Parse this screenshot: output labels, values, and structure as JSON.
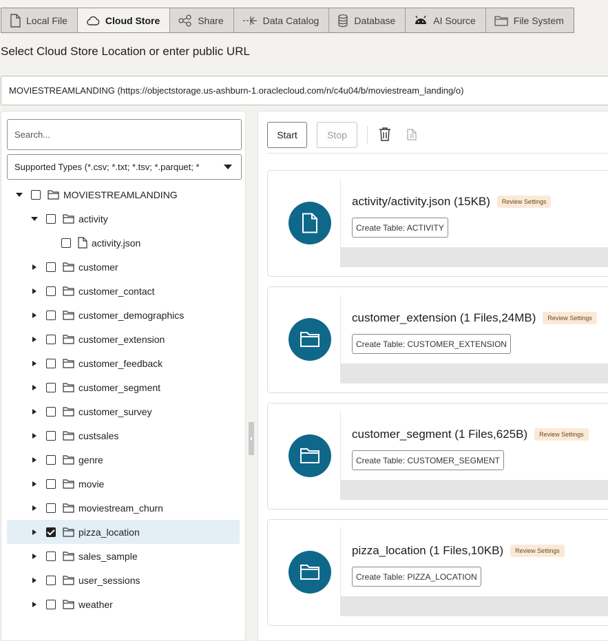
{
  "tabs": [
    {
      "label": "Local File",
      "icon": "file-icon",
      "active": false
    },
    {
      "label": "Cloud Store",
      "icon": "cloud-icon",
      "active": true
    },
    {
      "label": "Share",
      "icon": "share-icon",
      "active": false
    },
    {
      "label": "Data Catalog",
      "icon": "data-catalog-icon",
      "active": false
    },
    {
      "label": "Database",
      "icon": "database-icon",
      "active": false
    },
    {
      "label": "AI Source",
      "icon": "android-icon",
      "active": false
    },
    {
      "label": "File System",
      "icon": "folder-icon",
      "active": false
    }
  ],
  "page_title": "Select Cloud Store Location or enter public URL",
  "location": {
    "value": "MOVIESTREAMLANDING (https://objectstorage.us-ashburn-1.oraclecloud.com/n/c4u04/b/moviestream_landing/o)"
  },
  "search": {
    "placeholder": "Search...",
    "value": ""
  },
  "file_type_filter": {
    "selected": "Supported Types (*.csv; *.txt; *.tsv; *.parquet; *"
  },
  "tree": [
    {
      "label": "MOVIESTREAMLANDING",
      "type": "folder",
      "expander": "expanded",
      "checked": false,
      "level": 0,
      "selected": false
    },
    {
      "label": "activity",
      "type": "folder",
      "expander": "expanded",
      "checked": false,
      "level": 1,
      "selected": false
    },
    {
      "label": "activity.json",
      "type": "file",
      "expander": "none",
      "checked": false,
      "level": 2,
      "selected": false
    },
    {
      "label": "customer",
      "type": "folder",
      "expander": "collapsed",
      "checked": false,
      "level": 1,
      "selected": false
    },
    {
      "label": "customer_contact",
      "type": "folder",
      "expander": "collapsed",
      "checked": false,
      "level": 1,
      "selected": false
    },
    {
      "label": "customer_demographics",
      "type": "folder",
      "expander": "collapsed",
      "checked": false,
      "level": 1,
      "selected": false
    },
    {
      "label": "customer_extension",
      "type": "folder",
      "expander": "collapsed",
      "checked": false,
      "level": 1,
      "selected": false
    },
    {
      "label": "customer_feedback",
      "type": "folder",
      "expander": "collapsed",
      "checked": false,
      "level": 1,
      "selected": false
    },
    {
      "label": "customer_segment",
      "type": "folder",
      "expander": "collapsed",
      "checked": false,
      "level": 1,
      "selected": false
    },
    {
      "label": "customer_survey",
      "type": "folder",
      "expander": "collapsed",
      "checked": false,
      "level": 1,
      "selected": false
    },
    {
      "label": "custsales",
      "type": "folder",
      "expander": "collapsed",
      "checked": false,
      "level": 1,
      "selected": false
    },
    {
      "label": "genre",
      "type": "folder",
      "expander": "collapsed",
      "checked": false,
      "level": 1,
      "selected": false
    },
    {
      "label": "movie",
      "type": "folder",
      "expander": "collapsed",
      "checked": false,
      "level": 1,
      "selected": false
    },
    {
      "label": "moviestream_churn",
      "type": "folder",
      "expander": "collapsed",
      "checked": false,
      "level": 1,
      "selected": false
    },
    {
      "label": "pizza_location",
      "type": "folder",
      "expander": "collapsed",
      "checked": true,
      "level": 1,
      "selected": true
    },
    {
      "label": "sales_sample",
      "type": "folder",
      "expander": "collapsed",
      "checked": false,
      "level": 1,
      "selected": false
    },
    {
      "label": "user_sessions",
      "type": "folder",
      "expander": "collapsed",
      "checked": false,
      "level": 1,
      "selected": false
    },
    {
      "label": "weather",
      "type": "folder",
      "expander": "collapsed",
      "checked": false,
      "level": 1,
      "selected": false
    }
  ],
  "toolbar": {
    "start_label": "Start",
    "stop_label": "Stop",
    "delete_icon": "trash-icon",
    "settings_icon": "document-icon"
  },
  "cards": [
    {
      "title": "activity/activity.json (15KB)",
      "icon": "file-icon",
      "badge": "Review Settings",
      "action": "Create Table: ACTIVITY"
    },
    {
      "title": "customer_extension (1 Files,24MB)",
      "icon": "folder-icon",
      "badge": "Review Settings",
      "action": "Create Table: CUSTOMER_EXTENSION"
    },
    {
      "title": "customer_segment (1 Files,625B)",
      "icon": "folder-icon",
      "badge": "Review Settings",
      "action": "Create Table: CUSTOMER_SEGMENT"
    },
    {
      "title": "pizza_location (1 Files,10KB)",
      "icon": "folder-icon",
      "badge": "Review Settings",
      "action": "Create Table: PIZZA_LOCATION"
    }
  ],
  "colors": {
    "accent": "#0f6889",
    "badge_bg": "#fbe9d8",
    "selected_row": "#e3eef5",
    "page_bg": "#f4f2ee"
  }
}
